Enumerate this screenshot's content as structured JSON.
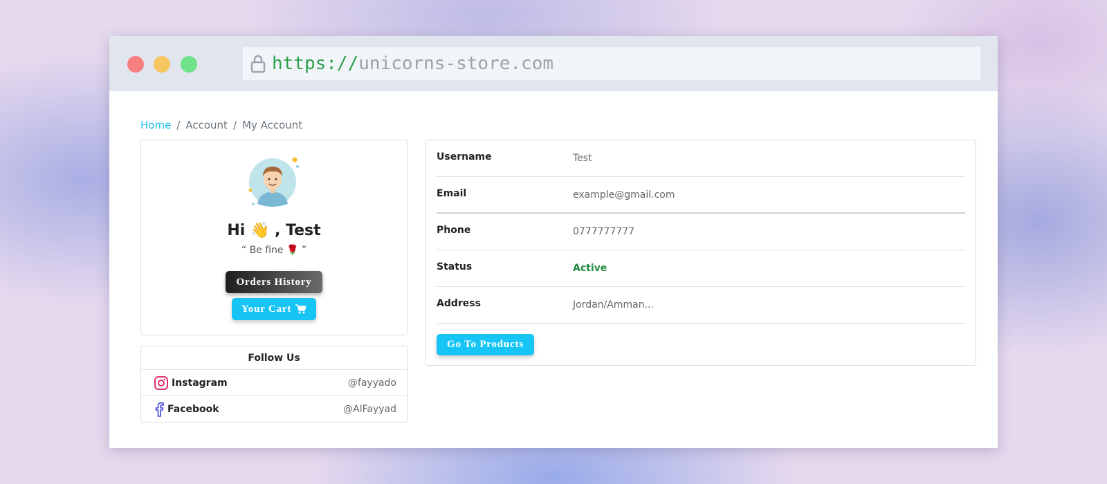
{
  "browser": {
    "url_scheme": "https://",
    "url_host": "unicorns-store.com"
  },
  "breadcrumb": {
    "home": "Home",
    "sep1": "/",
    "account": "Account",
    "sep2": "/",
    "current": "My Account"
  },
  "profile": {
    "greeting": "Hi 👋 , Test",
    "quote": "“ Be fine 🌹 ”",
    "orders_button": "Orders History",
    "cart_button": "Your Cart"
  },
  "follow": {
    "title": "Follow Us",
    "items": [
      {
        "network": "Instagram",
        "handle": "@fayyado",
        "color": "#e1306c"
      },
      {
        "network": "Facebook",
        "handle": "@AlFayyad",
        "color": "#3b45d9"
      }
    ]
  },
  "details": {
    "rows": [
      {
        "label": "Username",
        "value": "Test"
      },
      {
        "label": "Email",
        "value": "example@gmail.com"
      },
      {
        "label": "Phone",
        "value": "0777777777"
      },
      {
        "label": "Status",
        "value": "Active"
      },
      {
        "label": "Address",
        "value": "Jordan/Amman..."
      }
    ],
    "products_button": "Go To Products"
  },
  "colors": {
    "accent": "#17c5f5",
    "status_active": "#1e8a3e"
  }
}
